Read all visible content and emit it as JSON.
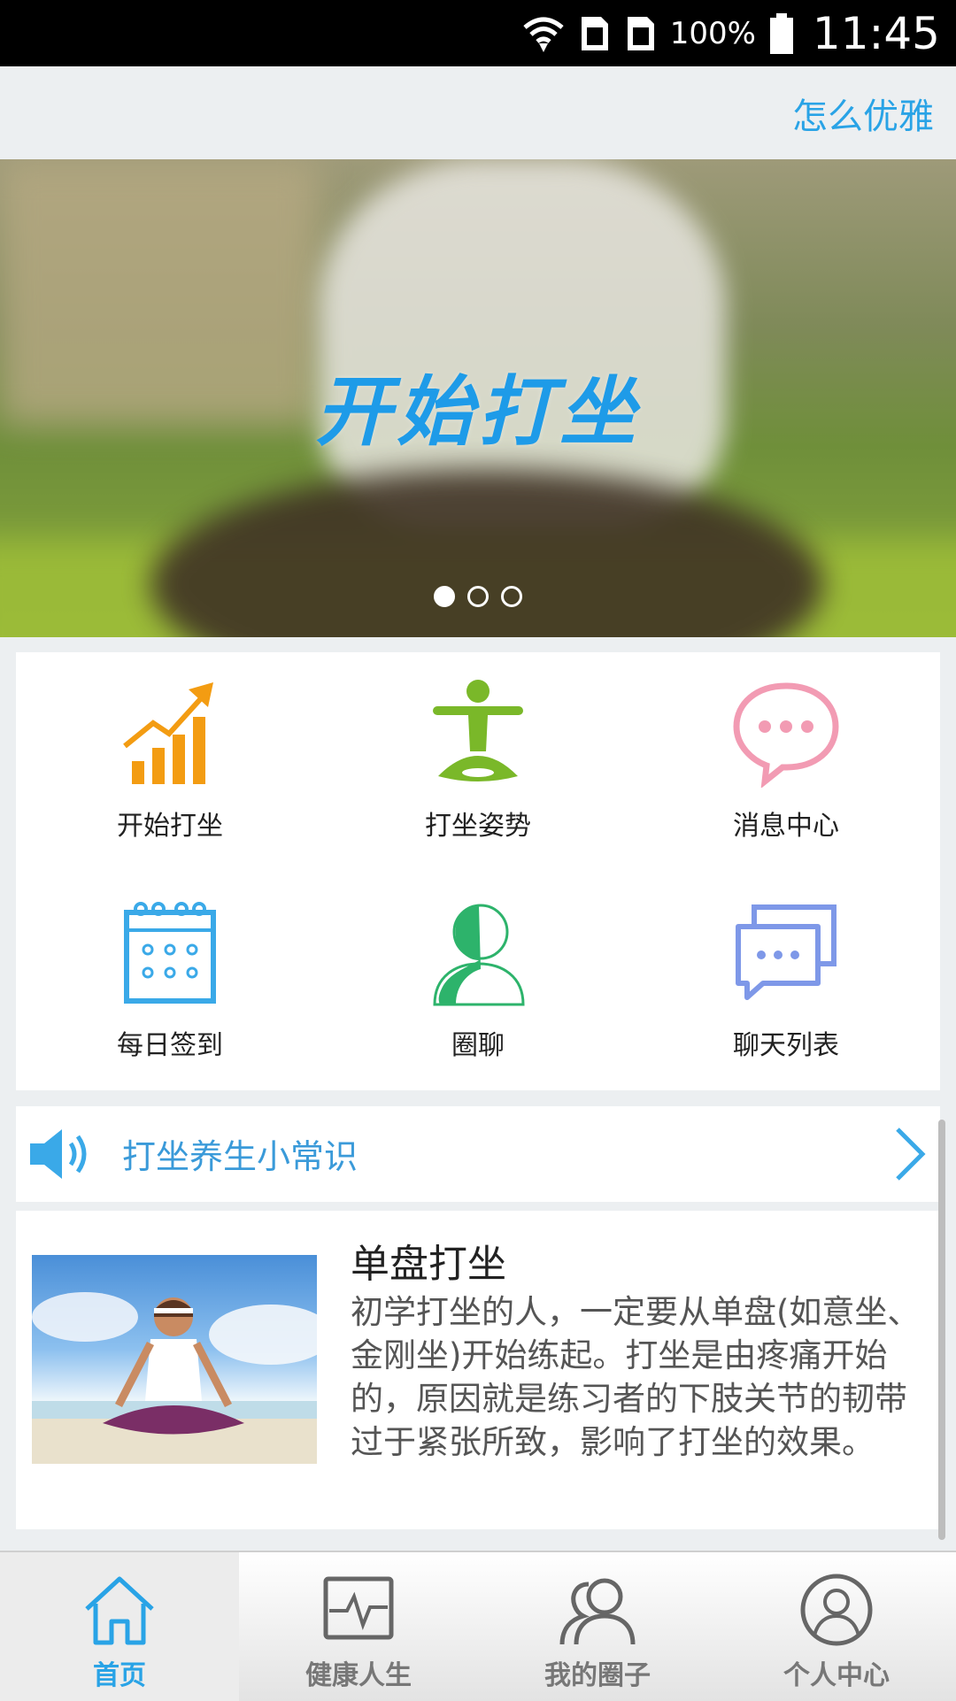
{
  "status_bar": {
    "battery": "100%",
    "time": "11:45"
  },
  "header": {
    "link": "怎么优雅"
  },
  "banner": {
    "title": "开始打坐",
    "pages": 3,
    "active_page": 1
  },
  "features": [
    {
      "label": "开始打坐",
      "icon": "growth-chart-icon"
    },
    {
      "label": "打坐姿势",
      "icon": "meditation-pose-icon"
    },
    {
      "label": "消息中心",
      "icon": "chat-bubble-icon"
    },
    {
      "label": "每日签到",
      "icon": "calendar-icon"
    },
    {
      "label": "圈聊",
      "icon": "user-icon"
    },
    {
      "label": "聊天列表",
      "icon": "chat-list-icon"
    }
  ],
  "notice": {
    "text": "打坐养生小常识"
  },
  "article": {
    "title": "单盘打坐",
    "body": "初学打坐的人，一定要从单盘(如意坐、金刚坐)开始练起。打坐是由疼痛开始的，原因就是练习者的下肢关节的韧带过于紧张所致，影响了打坐的效果。"
  },
  "tabs": [
    {
      "label": "首页",
      "icon": "home-icon",
      "active": true
    },
    {
      "label": "健康人生",
      "icon": "health-monitor-icon",
      "active": false
    },
    {
      "label": "我的圈子",
      "icon": "group-icon",
      "active": false
    },
    {
      "label": "个人中心",
      "icon": "profile-icon",
      "active": false
    }
  ],
  "colors": {
    "accent": "#29a3e6",
    "orange": "#f39c12",
    "green": "#7ab829",
    "pink": "#f29bb3"
  }
}
